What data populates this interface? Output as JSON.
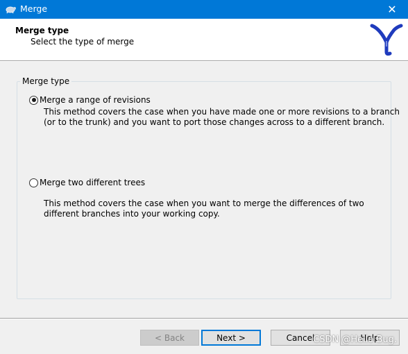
{
  "window": {
    "title": "Merge",
    "close_glyph": "✕"
  },
  "header": {
    "title": "Merge type",
    "subtitle": "Select the type of merge",
    "logo_icon": "merge-logo-icon"
  },
  "group": {
    "label": "Merge type"
  },
  "options": [
    {
      "label": "Merge a range of revisions",
      "selected": true,
      "description": "This method covers the case when you have made one or more revisions to a branch\n(or to the trunk) and you want to port those changes across to a different branch."
    },
    {
      "label": "Merge two different trees",
      "selected": false,
      "description": "This method covers the case when you want to merge the differences of two\ndifferent branches into your working copy."
    }
  ],
  "buttons": {
    "back": "< Back",
    "next": "Next >",
    "cancel": "Cancel",
    "help": "Help"
  },
  "watermark": "CSDN @Hello Bug.",
  "colors": {
    "titlebar": "#0078d7",
    "logo": "#1f3bbd",
    "focus": "#0078d7"
  }
}
